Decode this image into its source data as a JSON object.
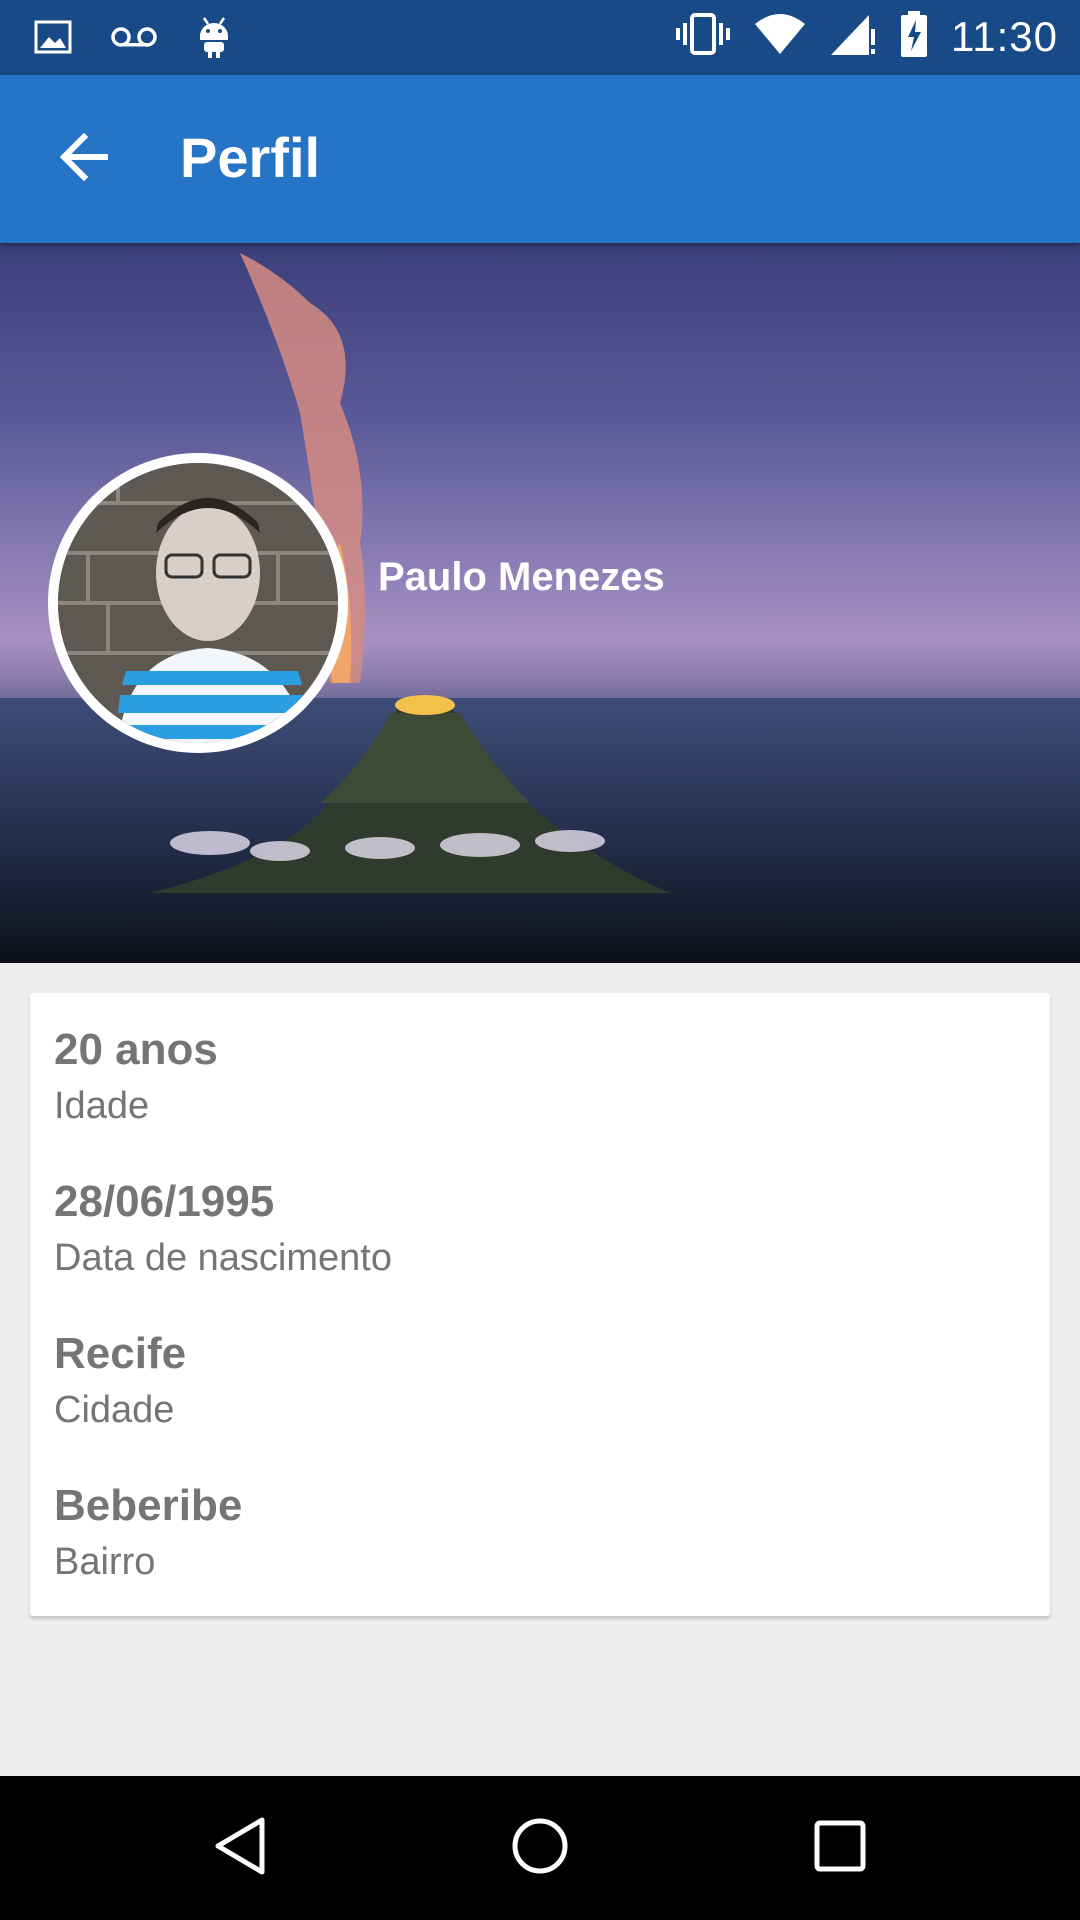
{
  "status_bar": {
    "time": "11:30",
    "left_icons": [
      "image-icon",
      "voicemail-icon",
      "android-icon"
    ],
    "right_icons": [
      "vibrate-icon",
      "wifi-icon",
      "signal-icon",
      "battery-charging-icon"
    ]
  },
  "app_bar": {
    "title": "Perfil",
    "back_icon": "arrow-back-icon",
    "color": "#2674c6"
  },
  "profile": {
    "name": "Paulo Menezes"
  },
  "info": [
    {
      "value": "20 anos",
      "label": "Idade"
    },
    {
      "value": "28/06/1995",
      "label": "Data de nascimento"
    },
    {
      "value": "Recife",
      "label": "Cidade"
    },
    {
      "value": "Beberibe",
      "label": "Bairro"
    }
  ],
  "nav_bar": {
    "buttons": [
      "back-triangle-icon",
      "home-circle-icon",
      "recents-square-icon"
    ]
  },
  "colors": {
    "status_bar": "#174a86",
    "app_bar": "#2674c6",
    "background": "#eeeeee",
    "text_secondary": "#757575"
  }
}
